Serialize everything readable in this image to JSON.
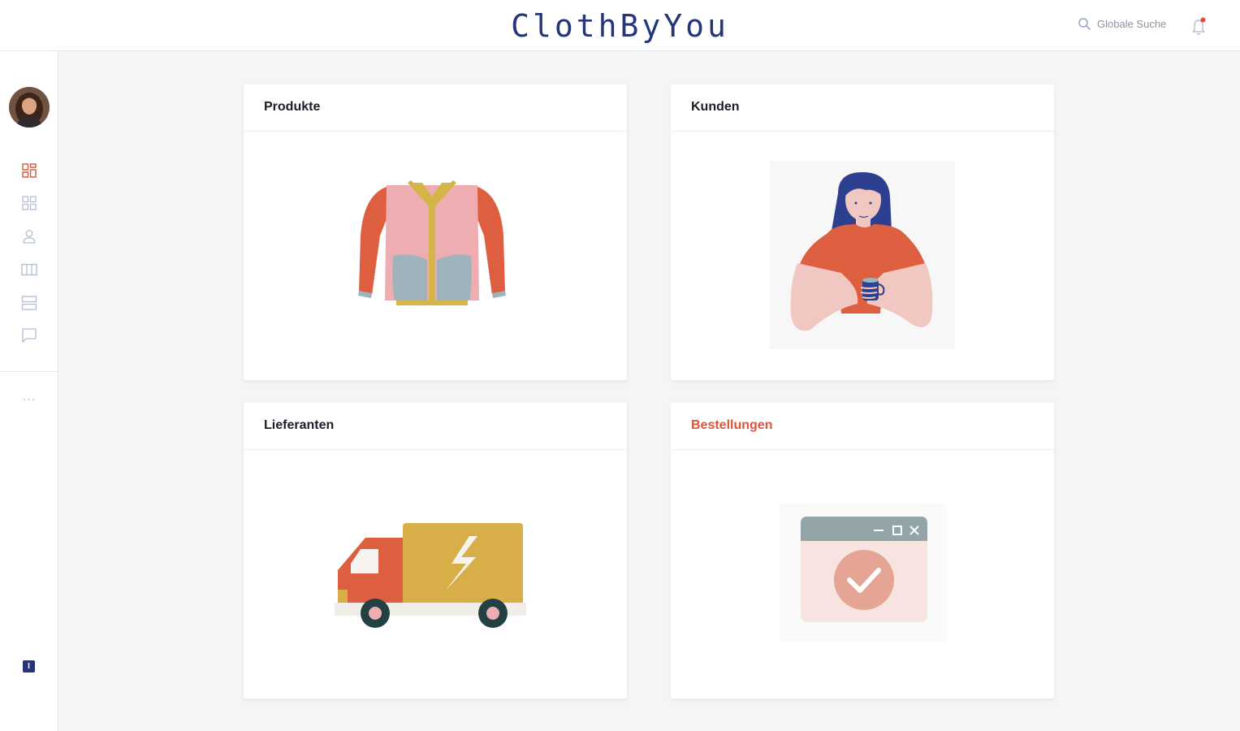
{
  "header": {
    "brand": "ClothByYou",
    "search_label": "Globale Suche"
  },
  "sidebar": {
    "items": [
      {
        "icon": "dashboard-icon",
        "active": true
      },
      {
        "icon": "grid-icon",
        "active": false
      },
      {
        "icon": "user-icon",
        "active": false
      },
      {
        "icon": "columns-icon",
        "active": false
      },
      {
        "icon": "rows-icon",
        "active": false
      },
      {
        "icon": "chat-icon",
        "active": false
      }
    ],
    "more_label": "···",
    "badge_label": "I"
  },
  "cards": [
    {
      "title": "Produkte",
      "illustration": "jacket-illustration"
    },
    {
      "title": "Kunden",
      "illustration": "customer-illustration"
    },
    {
      "title": "Lieferanten",
      "illustration": "truck-illustration"
    },
    {
      "title": "Bestellungen",
      "illustration": "order-confirmed-illustration",
      "active": true
    }
  ],
  "colors": {
    "brand": "#24357a",
    "accent": "#d9563b",
    "icon_inactive": "#9aa6c2",
    "background": "#f4f5f7"
  }
}
